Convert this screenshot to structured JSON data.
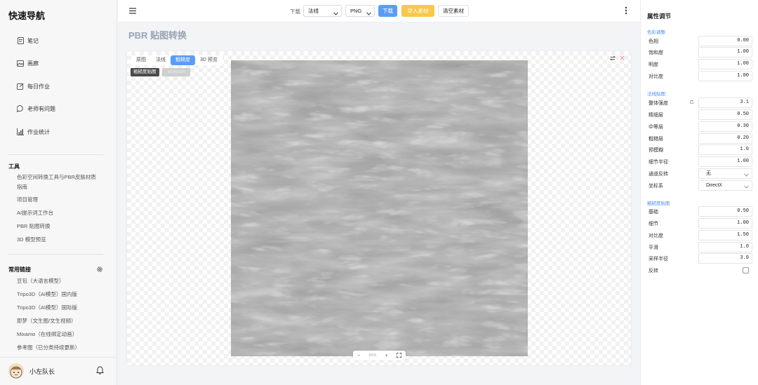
{
  "sidebar": {
    "brand": "快速导航",
    "nav": [
      {
        "label": "笔记",
        "icon": "note-icon"
      },
      {
        "label": "画廊",
        "icon": "image-icon"
      },
      {
        "label": "每日作业",
        "icon": "edit-icon"
      },
      {
        "label": "老师有问题",
        "icon": "chat-icon"
      },
      {
        "label": "作业统计",
        "icon": "bar-chart-icon"
      }
    ],
    "tools_title": "工具",
    "tools": [
      "色彩空间转换工具与PBR皮肤材质",
      "指南",
      "项目管理",
      "AI提示词工作台",
      "PBR 贴图转换",
      "3D 模型预览"
    ],
    "links_title": "常用链接",
    "links": [
      "豆包（大语言模型）",
      "Tripo3D（AI模型）国内版",
      "Tripo3D（AI模型）国际版",
      "即梦（文生图/文生视频）",
      "Mixamo（在线绑定动画）",
      "参考图（已分类持续更新）"
    ],
    "user_name": "小左队长"
  },
  "toolbar": {
    "download_label": "下载",
    "map_type": "法线",
    "format": "PNG",
    "download_button": "下载",
    "import_button": "导入素材",
    "clear_button": "清空素材"
  },
  "main": {
    "page_title": "PBR 贴图转换",
    "tabs": [
      "原图",
      "法线",
      "粗糙度",
      "3D 预览"
    ],
    "active_tab": "粗糙度",
    "chip_label": "粗糙度贴图",
    "chip_size": "1024x1024",
    "zoom": {
      "minus": "−",
      "value": "69%",
      "plus": "+"
    }
  },
  "properties": {
    "title": "属性调节",
    "color_group": "色彩调整",
    "color": [
      {
        "label": "色相",
        "value": "0.00"
      },
      {
        "label": "饱和度",
        "value": "1.00"
      },
      {
        "label": "明度",
        "value": "1.00"
      },
      {
        "label": "对比度",
        "value": "1.00"
      }
    ],
    "normal_group": "法线贴图",
    "normal": [
      {
        "label": "整体强度",
        "value": "3.1"
      },
      {
        "label": "精细层",
        "value": "0.50"
      },
      {
        "label": "中等层",
        "value": "0.30"
      },
      {
        "label": "粗糙层",
        "value": "0.20"
      },
      {
        "label": "预模糊",
        "value": "1.0"
      },
      {
        "label": "细节半径",
        "value": "1.00"
      }
    ],
    "channel_flip_label": "通道反转",
    "channel_flip_value": "无",
    "coord_label": "坐标系",
    "coord_value": "DirectX",
    "rough_group": "粗糙度贴图",
    "rough": [
      {
        "label": "基础",
        "value": "0.50"
      },
      {
        "label": "细节",
        "value": "1.00"
      },
      {
        "label": "对比度",
        "value": "1.50"
      },
      {
        "label": "平滑",
        "value": "1.0"
      },
      {
        "label": "采样半径",
        "value": "3.0"
      }
    ],
    "invert_label": "反转"
  },
  "colors": {
    "accent": "#5b9cf7",
    "import_button": "#f7c948",
    "group_title": "#4c8ef5"
  }
}
